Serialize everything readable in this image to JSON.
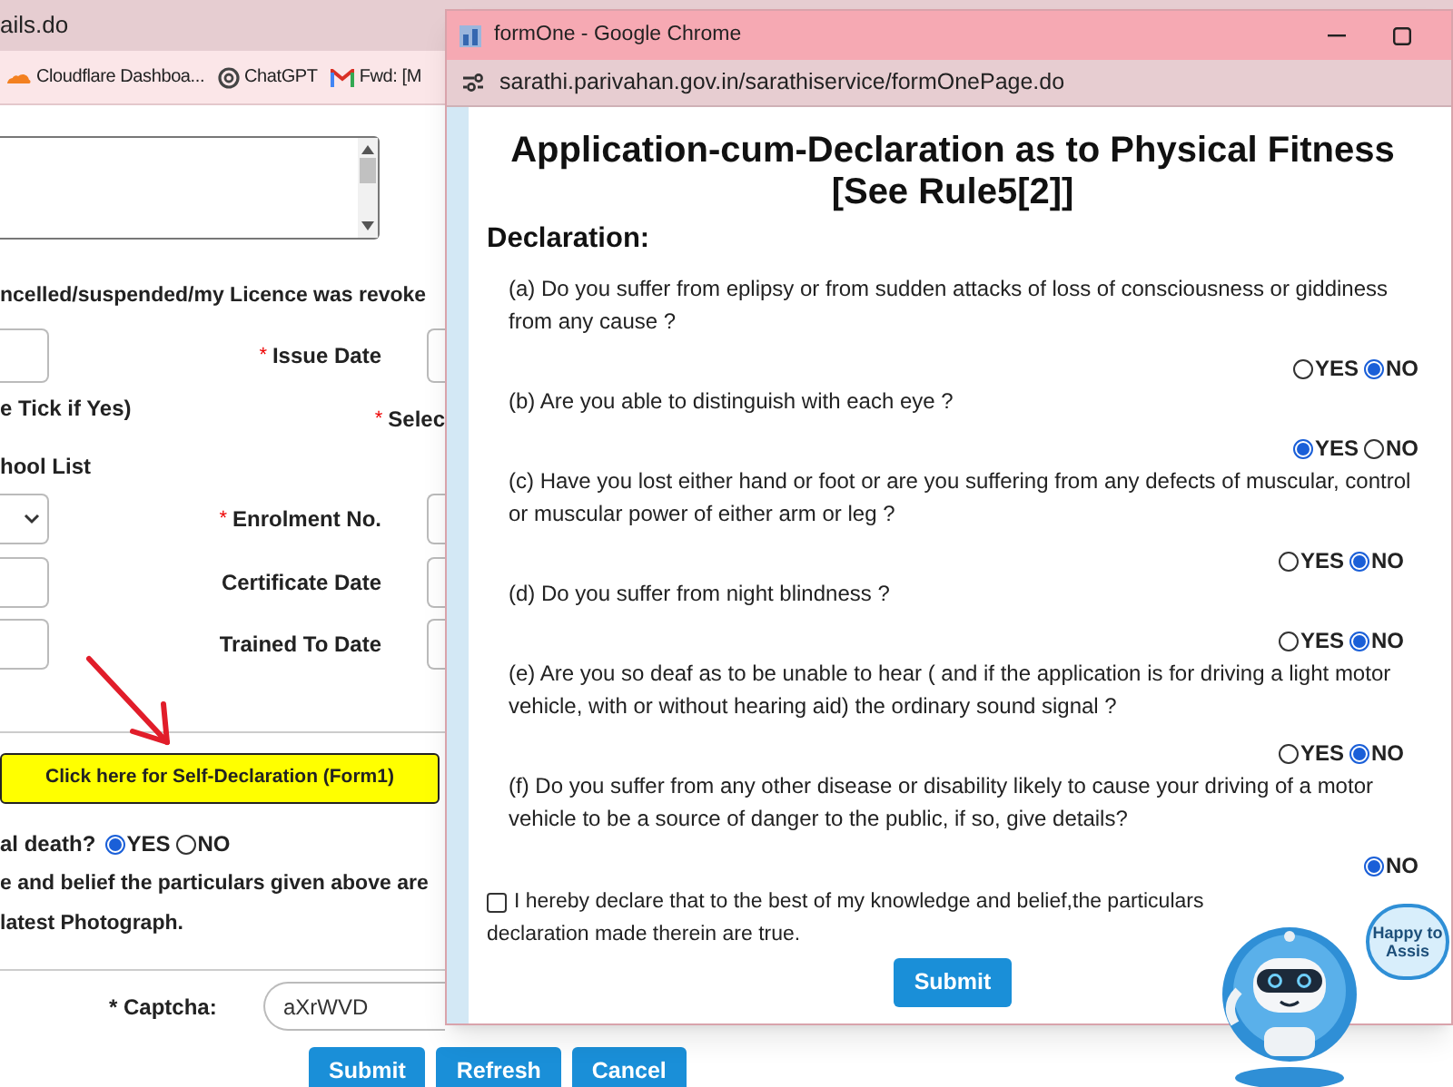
{
  "background_tab": {
    "title": "ails.do"
  },
  "bookmarks": [
    {
      "kind": "cloud",
      "label": "Cloudflare Dashboa..."
    },
    {
      "kind": "knot",
      "label": "ChatGPT"
    },
    {
      "kind": "mail",
      "label": "Fwd: [M"
    }
  ],
  "left_form": {
    "notice": "ncelled/suspended/my Licence was revoke",
    "issue_date": {
      "star": "*",
      "text": "Issue Date"
    },
    "tick_note": "e Tick if Yes)",
    "select_label": {
      "star": "*",
      "text": "Selec"
    },
    "school_list": "hool List",
    "rows": [
      {
        "kind": "select",
        "label": {
          "star": "*",
          "text": "Enrolment No."
        }
      },
      {
        "kind": "input",
        "label": {
          "text": "Certificate Date"
        }
      },
      {
        "kind": "input",
        "label": {
          "text": "Trained To Date"
        }
      }
    ],
    "self_declaration_button": "Click here for Self-Declaration (Form1)",
    "death_question": {
      "text": "al death?",
      "options": [
        {
          "label": "YES",
          "selected": true
        },
        {
          "label": "NO",
          "selected": false
        }
      ]
    },
    "belief_text": "e and belief the particulars given above are",
    "photo_text": "latest Photograph.",
    "captcha": {
      "label": "* Captcha:",
      "value": "aXrWVD"
    },
    "buttons": [
      "Submit",
      "Refresh",
      "Cancel"
    ]
  },
  "popup": {
    "title": "formOne - Google Chrome",
    "url": "sarathi.parivahan.gov.in/sarathiservice/formOnePage.do",
    "heading": [
      "Application-cum-Declaration as to Physical Fitness",
      "[See Rule5[2]]"
    ],
    "section": "Declaration:",
    "questions": [
      {
        "text": "(a) Do you suffer from eplipsy or from sudden attacks of loss of consciousness or giddiness from any cause ?",
        "options": [
          {
            "label": "YES",
            "selected": false
          },
          {
            "label": "NO",
            "selected": true
          }
        ]
      },
      {
        "text": "(b) Are you able to distinguish with each eye ?",
        "options": [
          {
            "label": "YES",
            "selected": true
          },
          {
            "label": "NO",
            "selected": false
          }
        ]
      },
      {
        "text": "(c) Have you lost either hand or foot or are you suffering from any defects of muscular, control or muscular power of either arm or leg ?",
        "options": [
          {
            "label": "YES",
            "selected": false
          },
          {
            "label": "NO",
            "selected": true
          }
        ]
      },
      {
        "text": "(d) Do you suffer from night blindness ?",
        "options": [
          {
            "label": "YES",
            "selected": false
          },
          {
            "label": "NO",
            "selected": true
          }
        ]
      },
      {
        "text": "(e) Are you so deaf as to be unable to hear ( and if the application is for driving a light motor vehicle, with or without hearing aid) the ordinary sound signal ?",
        "options": [
          {
            "label": "YES",
            "selected": false
          },
          {
            "label": "NO",
            "selected": true
          }
        ]
      },
      {
        "text": "(f) Do you suffer from any other disease or disability likely to cause your driving of a motor vehicle to be a source of danger to the public, if so, give details?",
        "options": [
          {
            "label": "NO",
            "selected": true
          }
        ]
      }
    ],
    "declaration": {
      "checked": false,
      "lines": [
        "I hereby declare that to the best of my knowledge and belief,the particulars",
        "declaration made therein are true."
      ]
    },
    "submit": "Submit"
  },
  "assistant": {
    "bubble": "Happy to Assis"
  }
}
